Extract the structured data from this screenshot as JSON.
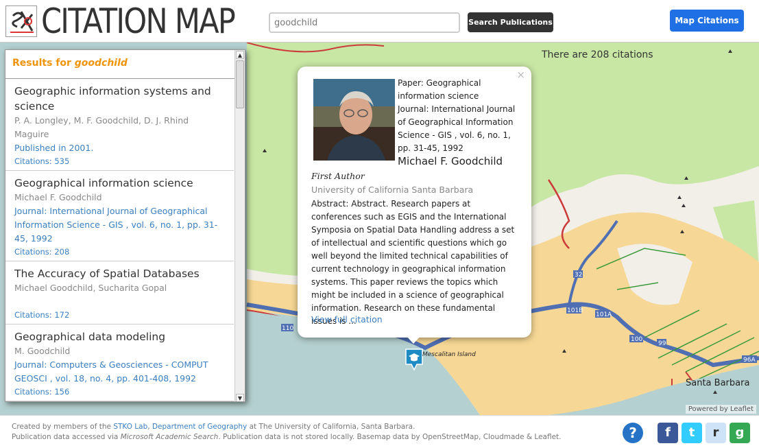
{
  "header": {
    "logo_text": "CITATION MAP",
    "search_value": "goodchild",
    "search_placeholder": "goodchild",
    "search_button": "Search Publications",
    "map_button": "Map Citations"
  },
  "map": {
    "citation_count": "There are 208 citations",
    "attribution": "Powered by Leaflet",
    "marker_label": "Mescalitan Island",
    "place_label": "Santa Barbara",
    "road_labels": [
      "32",
      "101B",
      "101A",
      "100",
      "99",
      "96A",
      "110"
    ],
    "colors": {
      "water": "#b5d0d0",
      "land": "#f2efe9",
      "urban": "#f6d795",
      "park": "#c8e6a4",
      "highway": "#4f6fb2",
      "road": "#cc3a3a"
    }
  },
  "sidebar": {
    "results_prefix": "Results for",
    "results_query": "goodchild",
    "results": [
      {
        "title": "Geographic information systems and science",
        "authors": "P. A. Longley, M. F. Goodchild, D. J. Rhind Maguire",
        "journal": "Published in 2001.",
        "citations": "Citations: 535"
      },
      {
        "title": "Geographical information science",
        "authors": "Michael F. Goodchild",
        "journal": "Journal: International Journal of Geographical Information Science - GIS , vol. 6, no. 1, pp. 31-45, 1992",
        "citations": "Citations: 208"
      },
      {
        "title": "The Accuracy of Spatial Databases",
        "authors": "Michael Goodchild, Sucharita Gopal",
        "journal": "",
        "citations": "Citations: 172"
      },
      {
        "title": "Geographical data modeling",
        "authors": "M. Goodchild",
        "journal": "Journal: Computers & Geosciences - COMPUT GEOSCI , vol. 18, no. 4, pp. 401-408, 1992",
        "citations": "Citations: 156"
      }
    ]
  },
  "popup": {
    "close": "×",
    "paper": "Paper: Geographical information science",
    "journal": "Journal: International Journal of Geographical Information Science - GIS , vol. 6, no. 1, pp. 31-45, 1992",
    "author_name": "Michael F. Goodchild",
    "first_author": "First Author",
    "affiliation": "University of California Santa Barbara",
    "abstract": "Abstract: Abstract. Research papers at conferences such as EGIS and the International Symposia on Spatial Data Handling address a set of intellectual and scientific questions which go well beyond the limited technical capabilities of current technology in geographical information systems. This paper reviews the topics which might be included in a science of geographical information. Research on these fundamental issues is ...",
    "view_link": "View full citation"
  },
  "footer": {
    "line1_prefix": "Created by members of the",
    "lab_link": "STKO Lab",
    "dept_link": "Department of Geography",
    "line1_suffix": "at The University of California, Santa Barbara.",
    "line2_prefix": "Publication data accessed via",
    "source": "Microsoft Academic Search",
    "line2_suffix": ". Publication data is not stored locally. Basemap data by OpenStreetMap, Cloudmade & Leaflet.",
    "help_icon": "?",
    "social": [
      {
        "name": "facebook-icon",
        "glyph": "f",
        "color": "#3b5998"
      },
      {
        "name": "twitter-icon",
        "glyph": "t",
        "color": "#33ccff"
      },
      {
        "name": "reddit-icon",
        "glyph": "r",
        "color": "#cee3f8"
      },
      {
        "name": "google-icon",
        "glyph": "g",
        "color": "#34a853"
      }
    ]
  }
}
